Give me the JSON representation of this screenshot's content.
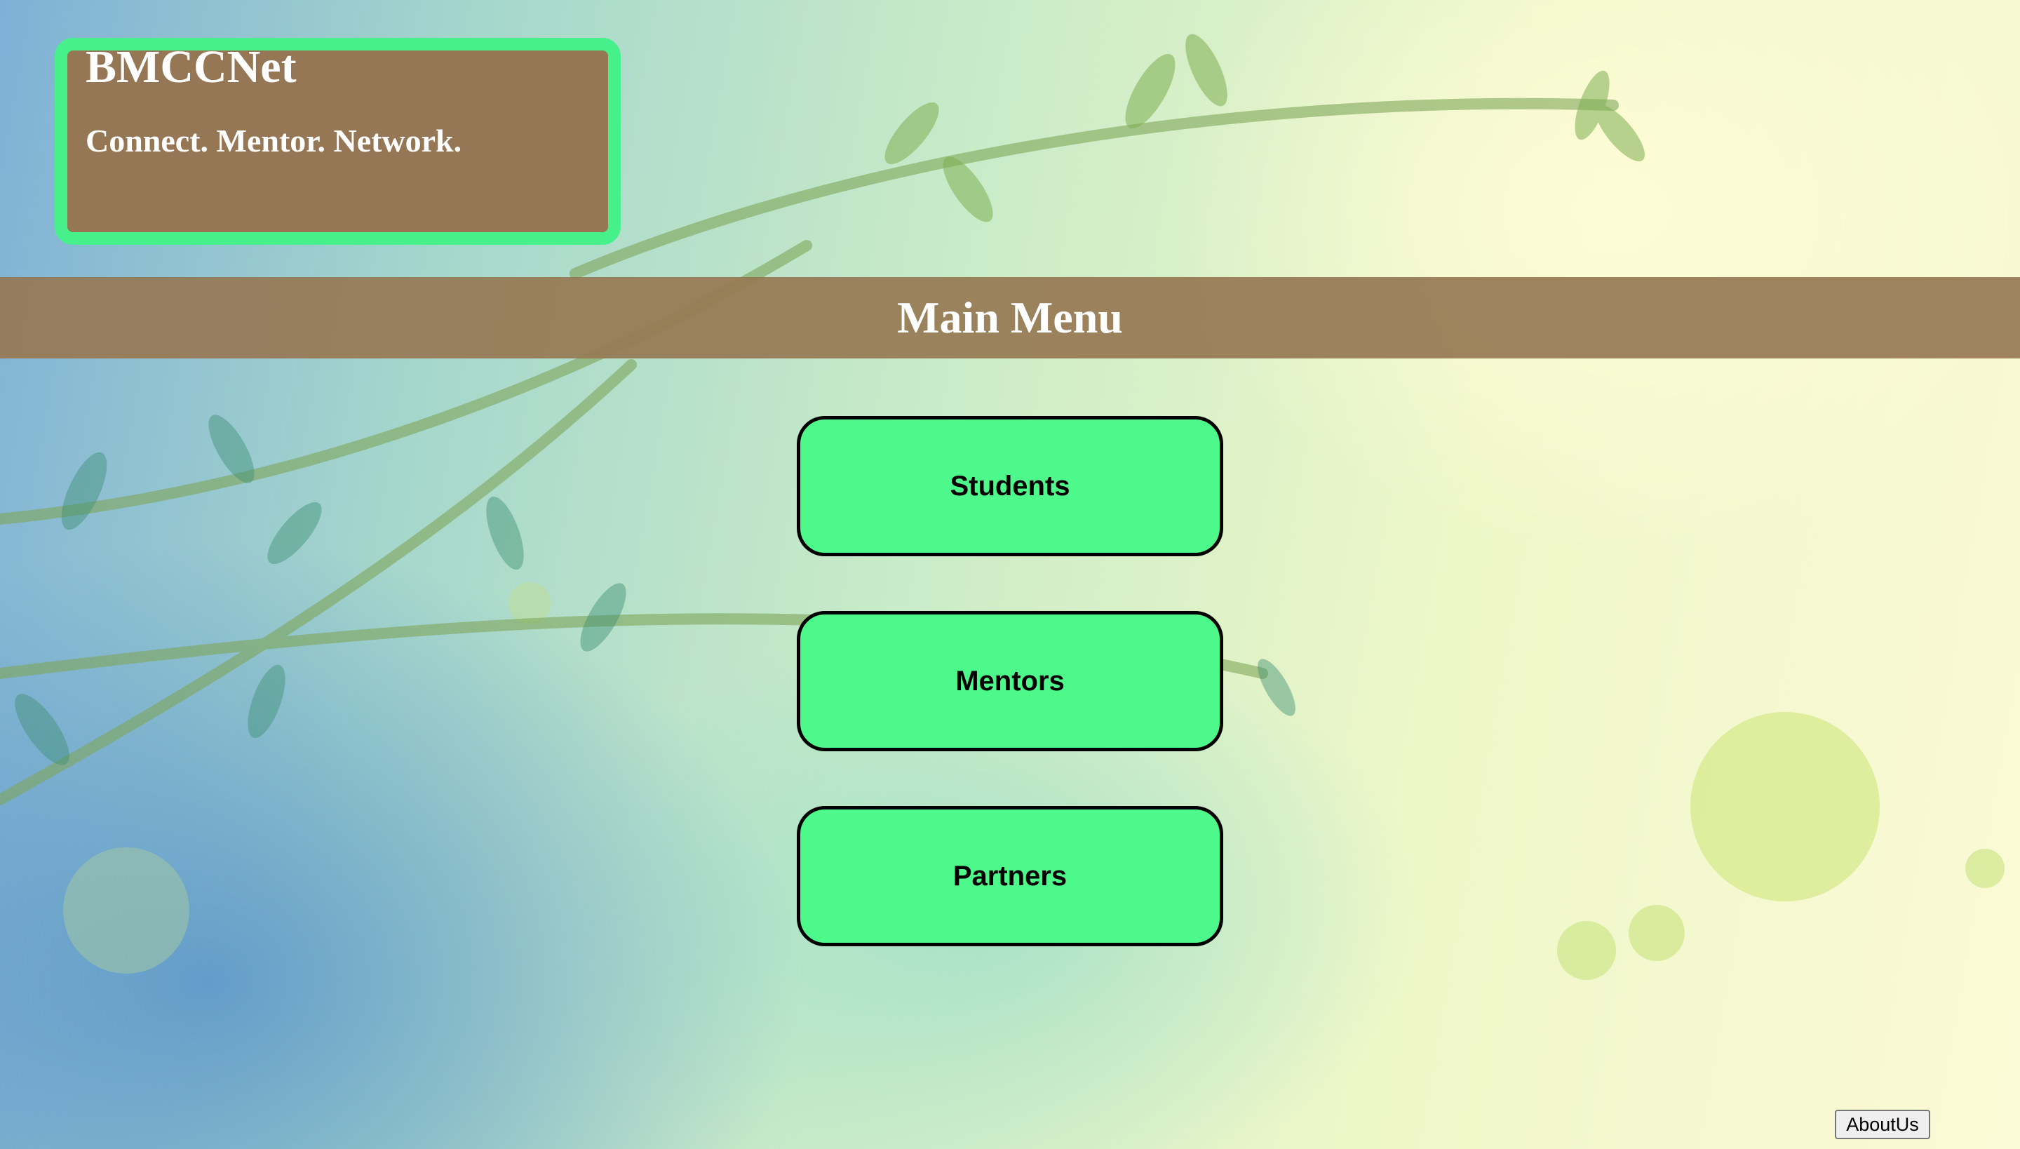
{
  "header": {
    "brand_title": "BMCCNet",
    "tagline": "Connect. Mentor. Network."
  },
  "menu": {
    "title": "Main Menu",
    "buttons": [
      {
        "label": "Students"
      },
      {
        "label": "Mentors"
      },
      {
        "label": "Partners"
      }
    ]
  },
  "footer": {
    "about_label": "AboutUs"
  },
  "colors": {
    "brand_box_fill": "#957755",
    "brand_box_border": "#46f18c",
    "menu_bar": "#96784f",
    "button_fill": "#4ef98c",
    "button_border": "#000000"
  }
}
